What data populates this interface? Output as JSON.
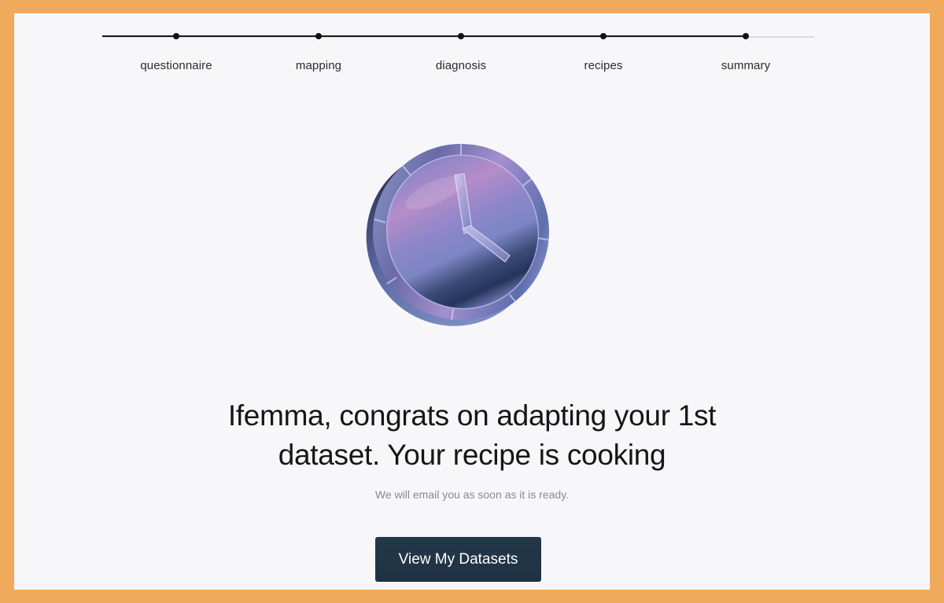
{
  "stepper": {
    "steps": [
      {
        "label": "questionnaire"
      },
      {
        "label": "mapping"
      },
      {
        "label": "diagnosis"
      },
      {
        "label": "recipes"
      },
      {
        "label": "summary"
      }
    ],
    "completed_steps": 5,
    "colors": {
      "active": "#111111",
      "inactive": "#d9d9dc"
    }
  },
  "illustration": {
    "icon": "clock-icon"
  },
  "main": {
    "headline_line1": "Ifemma, congrats on adapting your 1st",
    "headline_line2": "dataset. Your recipe is cooking",
    "subtext": "We will email you as soon as it is ready.",
    "cta_label": "View My Datasets"
  },
  "colors": {
    "page_border": "#f1a95c",
    "background": "#f7f7f9",
    "button": "#1f3446"
  }
}
